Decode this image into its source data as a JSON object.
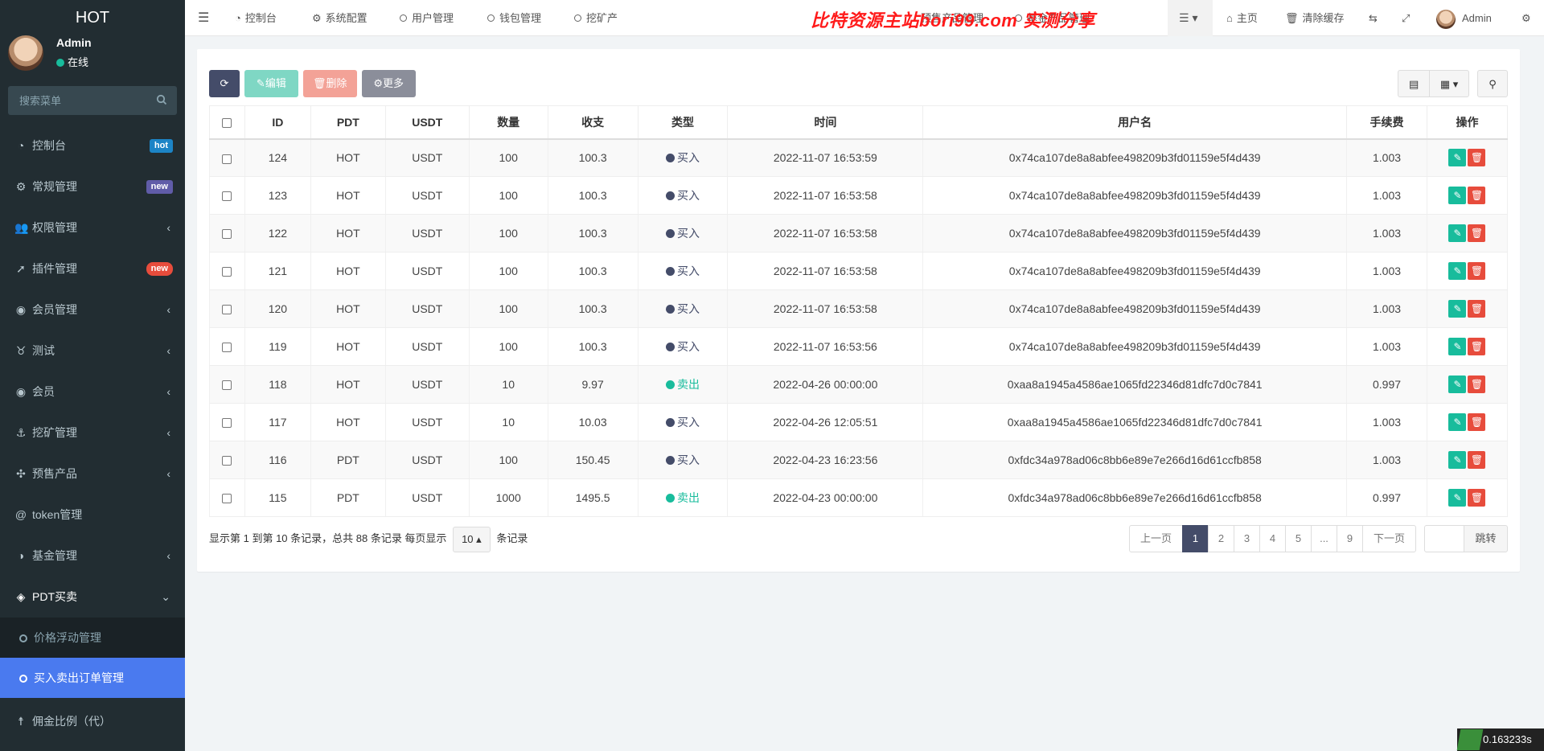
{
  "app": {
    "title": "HOT"
  },
  "user": {
    "name": "Admin",
    "status": "在线"
  },
  "sidebar": {
    "search_placeholder": "搜索菜单",
    "items": [
      {
        "label": "控制台",
        "icon": "dashboard-icon",
        "badge": "hot"
      },
      {
        "label": "常规管理",
        "icon": "cogs-icon",
        "badge": "new"
      },
      {
        "label": "权限管理",
        "icon": "group-icon"
      },
      {
        "label": "插件管理",
        "icon": "rocket-icon",
        "badge": "new"
      },
      {
        "label": "会员管理",
        "icon": "user-circle-icon"
      },
      {
        "label": "测试",
        "icon": "medal-icon"
      },
      {
        "label": "会员",
        "icon": "user-circle-icon"
      },
      {
        "label": "挖矿管理",
        "icon": "anchor-icon"
      },
      {
        "label": "预售产品",
        "icon": "pinwheel-icon"
      },
      {
        "label": "token管理",
        "icon": "at-icon"
      },
      {
        "label": "基金管理",
        "icon": "half-circle-icon"
      },
      {
        "label": "PDT买卖",
        "icon": "compass-icon"
      }
    ],
    "sub_items": [
      {
        "label": "价格浮动管理"
      },
      {
        "label": "买入卖出订单管理"
      }
    ],
    "last_item": {
      "label": "佣金比例（代）",
      "icon": "child-icon"
    }
  },
  "topnav": {
    "items": [
      "控制台",
      "系统配置",
      "用户管理",
      "钱包管理",
      "挖矿产",
      "预售产品管理",
      "基金产品管理"
    ],
    "watermark": "比特资源主站bori99.com 实测分享",
    "right": {
      "home": "主页",
      "clear_cache": "清除缓存",
      "admin": "Admin"
    }
  },
  "toolbar": {
    "edit": "编辑",
    "delete": "删除",
    "more": "更多"
  },
  "table": {
    "headers": [
      "ID",
      "PDT",
      "USDT",
      "数量",
      "收支",
      "类型",
      "时间",
      "用户名",
      "手续费",
      "操作"
    ],
    "rows": [
      {
        "id": "124",
        "pdt": "HOT",
        "usdt": "USDT",
        "qty": "100",
        "amount": "100.3",
        "type": "买入",
        "time": "2022-11-07 16:53:59",
        "username": "0x74ca107de8a8abfee498209b3fd01159e5f4d439",
        "fee": "1.003"
      },
      {
        "id": "123",
        "pdt": "HOT",
        "usdt": "USDT",
        "qty": "100",
        "amount": "100.3",
        "type": "买入",
        "time": "2022-11-07 16:53:58",
        "username": "0x74ca107de8a8abfee498209b3fd01159e5f4d439",
        "fee": "1.003"
      },
      {
        "id": "122",
        "pdt": "HOT",
        "usdt": "USDT",
        "qty": "100",
        "amount": "100.3",
        "type": "买入",
        "time": "2022-11-07 16:53:58",
        "username": "0x74ca107de8a8abfee498209b3fd01159e5f4d439",
        "fee": "1.003"
      },
      {
        "id": "121",
        "pdt": "HOT",
        "usdt": "USDT",
        "qty": "100",
        "amount": "100.3",
        "type": "买入",
        "time": "2022-11-07 16:53:58",
        "username": "0x74ca107de8a8abfee498209b3fd01159e5f4d439",
        "fee": "1.003"
      },
      {
        "id": "120",
        "pdt": "HOT",
        "usdt": "USDT",
        "qty": "100",
        "amount": "100.3",
        "type": "买入",
        "time": "2022-11-07 16:53:58",
        "username": "0x74ca107de8a8abfee498209b3fd01159e5f4d439",
        "fee": "1.003"
      },
      {
        "id": "119",
        "pdt": "HOT",
        "usdt": "USDT",
        "qty": "100",
        "amount": "100.3",
        "type": "买入",
        "time": "2022-11-07 16:53:56",
        "username": "0x74ca107de8a8abfee498209b3fd01159e5f4d439",
        "fee": "1.003"
      },
      {
        "id": "118",
        "pdt": "HOT",
        "usdt": "USDT",
        "qty": "10",
        "amount": "9.97",
        "type": "卖出",
        "time": "2022-04-26 00:00:00",
        "username": "0xaa8a1945a4586ae1065fd22346d81dfc7d0c7841",
        "fee": "0.997"
      },
      {
        "id": "117",
        "pdt": "HOT",
        "usdt": "USDT",
        "qty": "10",
        "amount": "10.03",
        "type": "买入",
        "time": "2022-04-26 12:05:51",
        "username": "0xaa8a1945a4586ae1065fd22346d81dfc7d0c7841",
        "fee": "1.003"
      },
      {
        "id": "116",
        "pdt": "PDT",
        "usdt": "USDT",
        "qty": "100",
        "amount": "150.45",
        "type": "买入",
        "time": "2022-04-23 16:23:56",
        "username": "0xfdc34a978ad06c8bb6e89e7e266d16d61ccfb858",
        "fee": "1.003"
      },
      {
        "id": "115",
        "pdt": "PDT",
        "usdt": "USDT",
        "qty": "1000",
        "amount": "1495.5",
        "type": "卖出",
        "time": "2022-04-23 00:00:00",
        "username": "0xfdc34a978ad06c8bb6e89e7e266d16d61ccfb858",
        "fee": "0.997"
      }
    ]
  },
  "footer": {
    "info_prefix": "显示第 1 到第 10 条记录，总共 88 条记录 每页显示",
    "page_size": "10",
    "info_suffix": "条记录"
  },
  "pagination": {
    "prev": "上一页",
    "pages": [
      "1",
      "2",
      "3",
      "4",
      "5",
      "...",
      "9"
    ],
    "next": "下一页",
    "go": "跳转"
  },
  "timer": "0.163233s",
  "colors": {
    "sidebar_bg": "#222d32",
    "active": "#4a7aef",
    "buy": "#444c69",
    "sell": "#18bc9c",
    "danger": "#e74c3c"
  }
}
